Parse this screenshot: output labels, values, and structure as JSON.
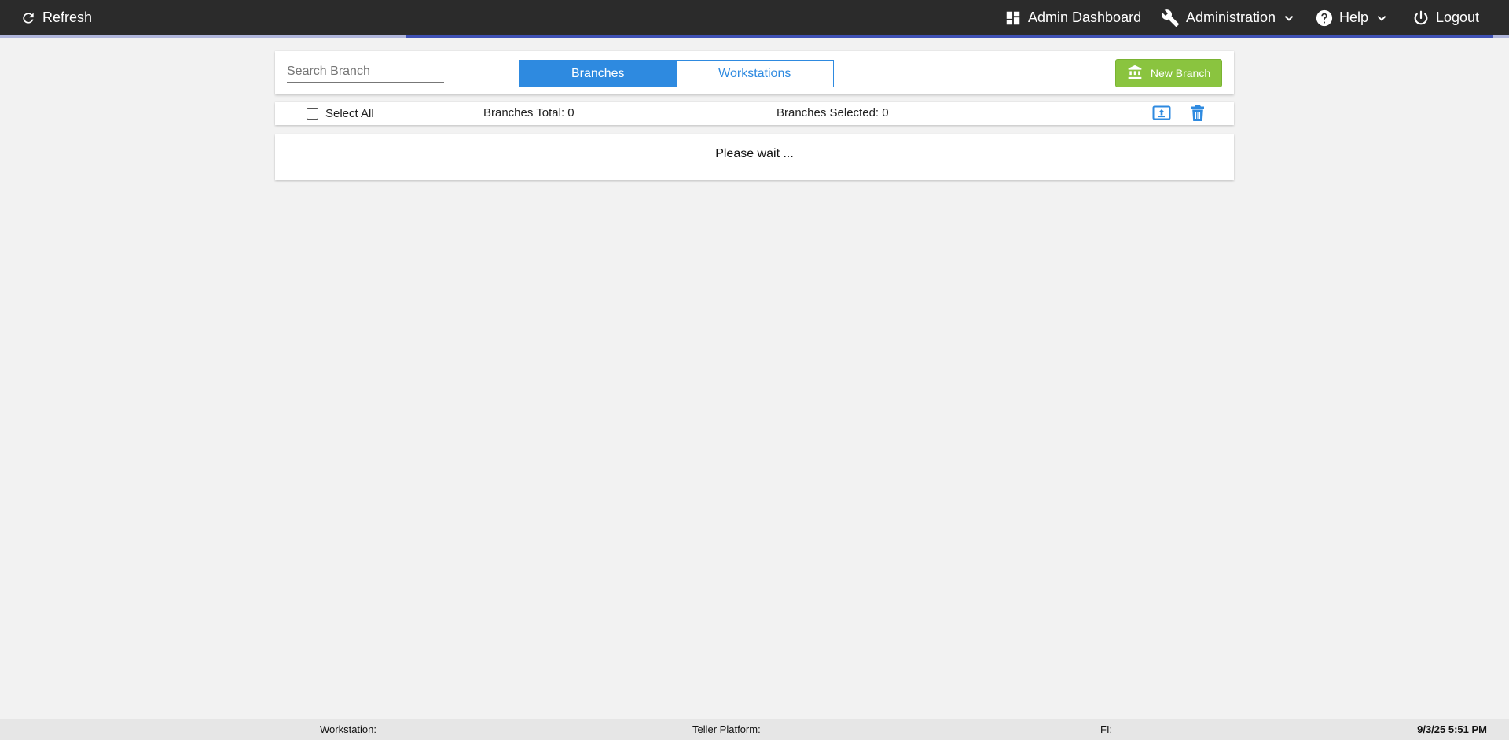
{
  "topbar": {
    "refresh_label": "Refresh",
    "admin_dashboard_label": "Admin Dashboard",
    "administration_label": "Administration",
    "help_label": "Help",
    "logout_label": "Logout",
    "background": "#2b2b2b",
    "progress_color": "#3f51b5"
  },
  "toolbar": {
    "search_placeholder": "Search Branch",
    "search_value": "",
    "tabs": [
      {
        "label": "Branches",
        "active": true
      },
      {
        "label": "Workstations",
        "active": false
      }
    ],
    "new_button_label": "New Branch",
    "new_button_color": "#8ac43f",
    "accent_color": "#2e8ae0"
  },
  "selection": {
    "select_all_label": "Select All",
    "select_all_checked": false,
    "total_text": "Branches Total: 0",
    "selected_text": "Branches Selected: 0",
    "icons": [
      "upload-icon",
      "trash-icon"
    ]
  },
  "content": {
    "status_text": "Please wait ..."
  },
  "footer": {
    "workstation_label": "Workstation:",
    "teller_platform_label": "Teller Platform:",
    "fi_label": "FI:",
    "timestamp": "9/3/25 5:51 PM"
  }
}
